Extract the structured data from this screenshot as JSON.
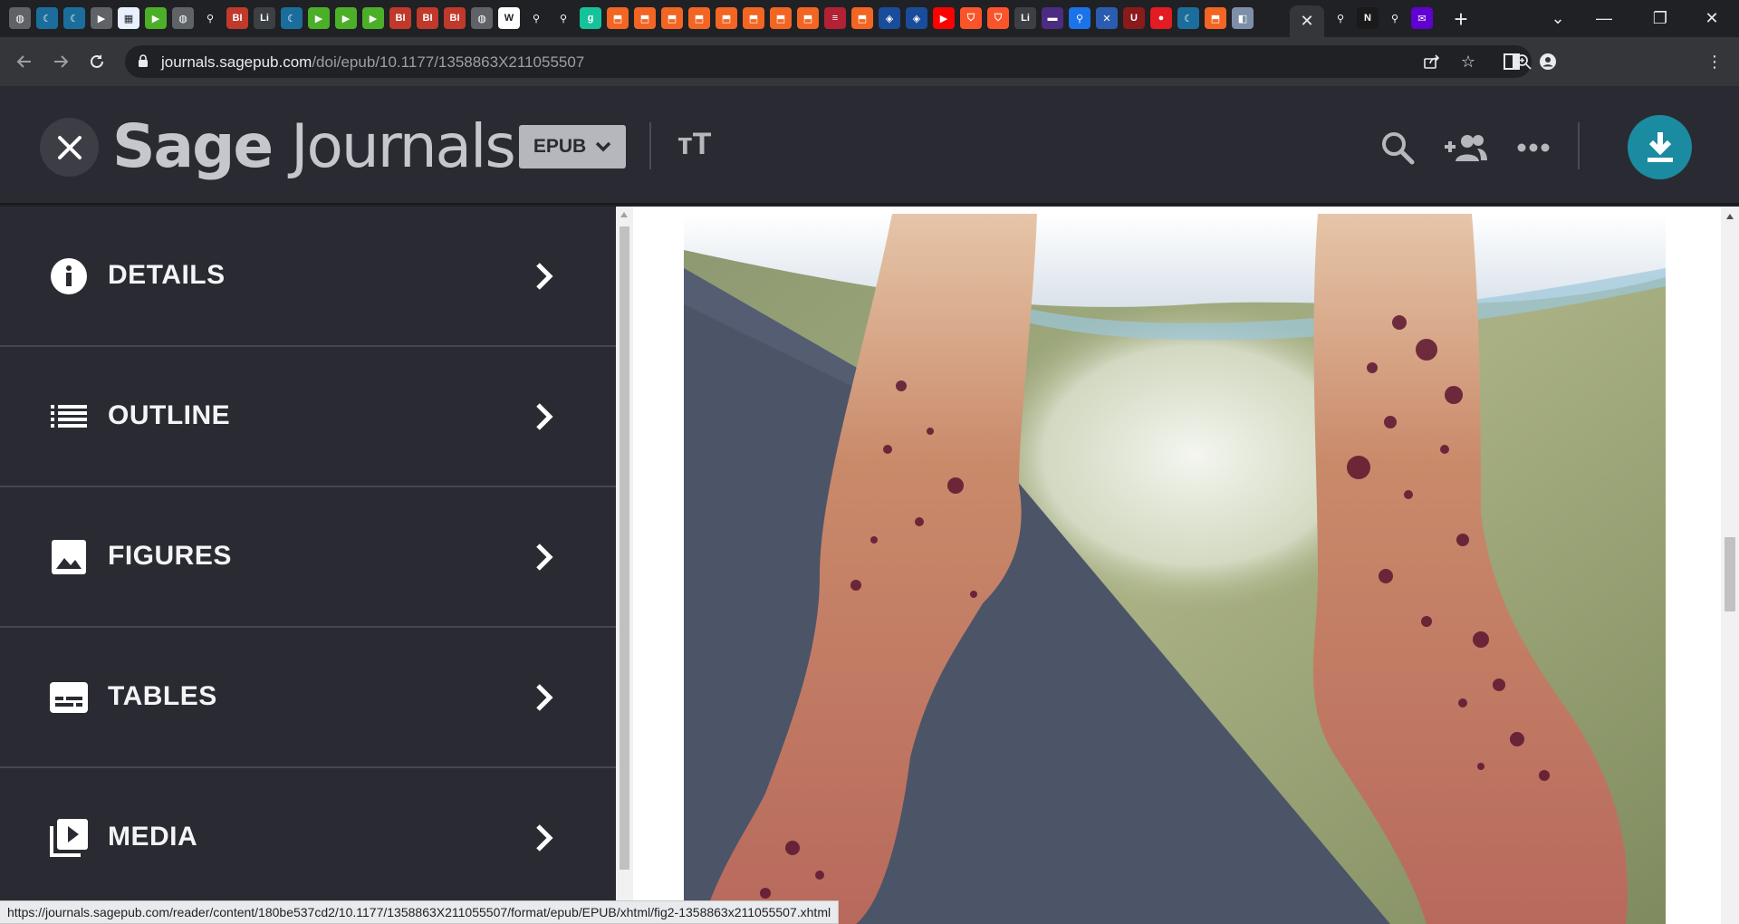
{
  "browser": {
    "url_host": "journals.sagepub.com",
    "url_path": "/doi/epub/10.1177/1358863X211055507",
    "status_url": "https://journals.sagepub.com/reader/content/180be537cd2/10.1177/1358863X211055507/format/epub/EPUB/xhtml/fig2-1358863x211055507.xhtml",
    "tab_icons": [
      {
        "icon": "globe-icon",
        "color": "#5f6368",
        "glyph": "◍"
      },
      {
        "icon": "shield-icon",
        "color": "#1b6e9c",
        "glyph": "☾"
      },
      {
        "icon": "shield-icon",
        "color": "#1b6e9c",
        "glyph": "☾"
      },
      {
        "icon": "tag-icon",
        "color": "#5f6368",
        "glyph": "▶"
      },
      {
        "icon": "grid-icon",
        "color": "#e8f0fe",
        "glyph": "▦"
      },
      {
        "icon": "play-icon",
        "color": "#4caf28",
        "glyph": "▶"
      },
      {
        "icon": "globe-icon",
        "color": "#5f6368",
        "glyph": "◍"
      },
      {
        "icon": "search-icon",
        "color": "#202124",
        "glyph": "⚲"
      },
      {
        "icon": "bi-icon",
        "color": "#c0392b",
        "glyph": "BI"
      },
      {
        "icon": "text-icon",
        "color": "#3c4043",
        "glyph": "Li"
      },
      {
        "icon": "shield-icon",
        "color": "#1b6e9c",
        "glyph": "☾"
      },
      {
        "icon": "play-icon",
        "color": "#4caf28",
        "glyph": "▶"
      },
      {
        "icon": "play-icon",
        "color": "#4caf28",
        "glyph": "▶"
      },
      {
        "icon": "play-icon",
        "color": "#4caf28",
        "glyph": "▶"
      },
      {
        "icon": "bi-icon",
        "color": "#c0392b",
        "glyph": "BI"
      },
      {
        "icon": "bi-icon",
        "color": "#c0392b",
        "glyph": "BI"
      },
      {
        "icon": "bi-icon",
        "color": "#c0392b",
        "glyph": "BI"
      },
      {
        "icon": "globe-icon",
        "color": "#5f6368",
        "glyph": "◍"
      },
      {
        "icon": "news-icon",
        "color": "#ffffff",
        "glyph": "W"
      },
      {
        "icon": "search-icon",
        "color": "#202124",
        "glyph": "⚲"
      },
      {
        "icon": "search-icon",
        "color": "#202124",
        "glyph": "⚲"
      },
      {
        "icon": "g-icon",
        "color": "#15c39a",
        "glyph": "g"
      },
      {
        "icon": "bookmark-icon",
        "color": "#f26522",
        "glyph": "⬒"
      },
      {
        "icon": "bookmark-icon",
        "color": "#f26522",
        "glyph": "⬒"
      },
      {
        "icon": "bookmark-icon",
        "color": "#f26522",
        "glyph": "⬒"
      },
      {
        "icon": "bookmark-icon",
        "color": "#f26522",
        "glyph": "⬒"
      },
      {
        "icon": "bookmark-icon",
        "color": "#f26522",
        "glyph": "⬒"
      },
      {
        "icon": "bookmark-icon",
        "color": "#f26522",
        "glyph": "⬒"
      },
      {
        "icon": "bookmark-icon",
        "color": "#f26522",
        "glyph": "⬒"
      },
      {
        "icon": "bookmark-icon",
        "color": "#f26522",
        "glyph": "⬒"
      },
      {
        "icon": "flag-icon",
        "color": "#b22234",
        "glyph": "≡"
      },
      {
        "icon": "bookmark-icon",
        "color": "#f26522",
        "glyph": "⬒"
      },
      {
        "icon": "cube-icon",
        "color": "#1a4c9c",
        "glyph": "◈"
      },
      {
        "icon": "cube-icon",
        "color": "#1a4c9c",
        "glyph": "◈"
      },
      {
        "icon": "youtube-icon",
        "color": "#ff0000",
        "glyph": "▶"
      },
      {
        "icon": "brave-icon",
        "color": "#fb542b",
        "glyph": "⛉"
      },
      {
        "icon": "brave-icon",
        "color": "#fb542b",
        "glyph": "⛉"
      },
      {
        "icon": "text-icon",
        "color": "#3c4043",
        "glyph": "Li"
      },
      {
        "icon": "tv-icon",
        "color": "#4b2c82",
        "glyph": "▬"
      },
      {
        "icon": "search-icon",
        "color": "#1a73e8",
        "glyph": "⚲"
      },
      {
        "icon": "shield-icon",
        "color": "#2a5db0",
        "glyph": "✕"
      },
      {
        "icon": "uni-icon",
        "color": "#8b1a1a",
        "glyph": "U"
      },
      {
        "icon": "mic-icon",
        "color": "#e31b23",
        "glyph": "●"
      },
      {
        "icon": "shield-icon",
        "color": "#1b6e9c",
        "glyph": "☾"
      },
      {
        "icon": "bookmark-icon",
        "color": "#f26522",
        "glyph": "⬒"
      },
      {
        "icon": "photo-icon",
        "color": "#7d8ea8",
        "glyph": "◧"
      }
    ],
    "tab_icons_after": [
      {
        "icon": "search-icon",
        "color": "#202124",
        "glyph": "⚲"
      },
      {
        "icon": "news-icon",
        "color": "#1a1a1a",
        "glyph": "N"
      },
      {
        "icon": "search-icon",
        "color": "#202124",
        "glyph": "⚲"
      },
      {
        "icon": "mail-icon",
        "color": "#6001d2",
        "glyph": "✉"
      }
    ]
  },
  "app": {
    "logo_part1": "Sage",
    "logo_part2": "Journals",
    "format_label": "EPUB",
    "text_size_label": "тT",
    "accent": "#1b8ba1"
  },
  "sidebar": {
    "items": [
      {
        "label": "DETAILS",
        "icon": "info-icon"
      },
      {
        "label": "OUTLINE",
        "icon": "list-icon"
      },
      {
        "label": "FIGURES",
        "icon": "image-icon"
      },
      {
        "label": "TABLES",
        "icon": "table-icon"
      },
      {
        "label": "MEDIA",
        "icon": "media-icon"
      }
    ]
  }
}
